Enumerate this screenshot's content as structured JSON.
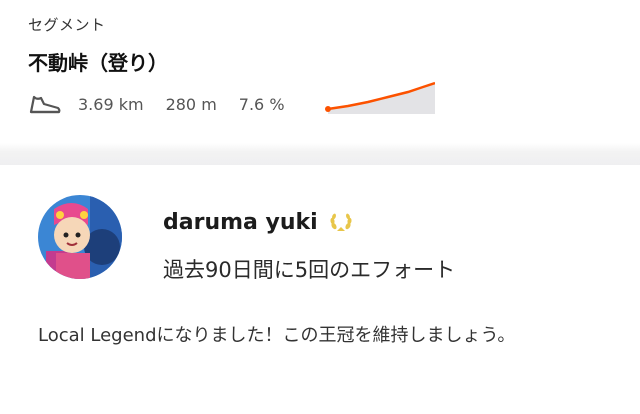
{
  "segment": {
    "section_label": "セグメント",
    "title": "不動峠（登り）",
    "distance": "3.69 km",
    "elevation": "280 m",
    "grade": "7.6 %",
    "sport_icon": "shoe-icon",
    "accent_color": "#fc5200"
  },
  "local_legend": {
    "athlete_name": "daruma yuki",
    "badge_icon": "laurel-icon",
    "badge_color": "#e8c64a",
    "effort_count": "過去90日間に5回のエフォート",
    "message": "Local Legendになりました！この王冠を維持しましょう。"
  }
}
